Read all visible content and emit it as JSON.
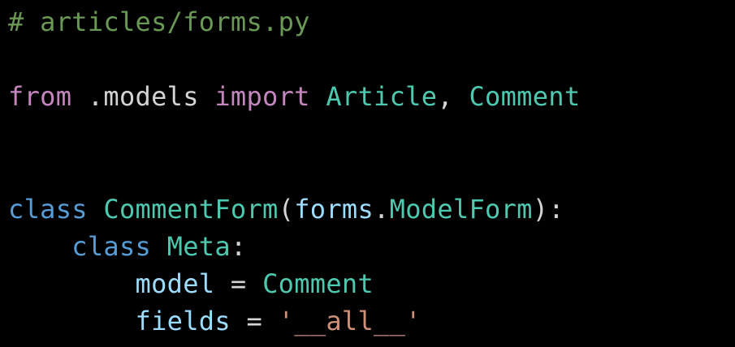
{
  "editor": {
    "line1": {
      "comment": "# articles/forms.py"
    },
    "line3": {
      "from_kw": "from",
      "module": " .models ",
      "import_kw": "import",
      "space": " ",
      "name1": "Article",
      "comma": ", ",
      "name2": "Comment"
    },
    "line6": {
      "class_kw": "class",
      "space": " ",
      "class_name": "CommentForm",
      "open_paren": "(",
      "base_module": "forms",
      "dot": ".",
      "base_class": "ModelForm",
      "close": "):"
    },
    "line7": {
      "indent": "    ",
      "class_kw": "class",
      "space": " ",
      "class_name": "Meta",
      "colon": ":"
    },
    "line8": {
      "indent": "        ",
      "attr": "model",
      "eq": " = ",
      "value": "Comment"
    },
    "line9": {
      "indent": "        ",
      "attr": "fields",
      "eq": " = ",
      "value": "'__all__'"
    }
  }
}
